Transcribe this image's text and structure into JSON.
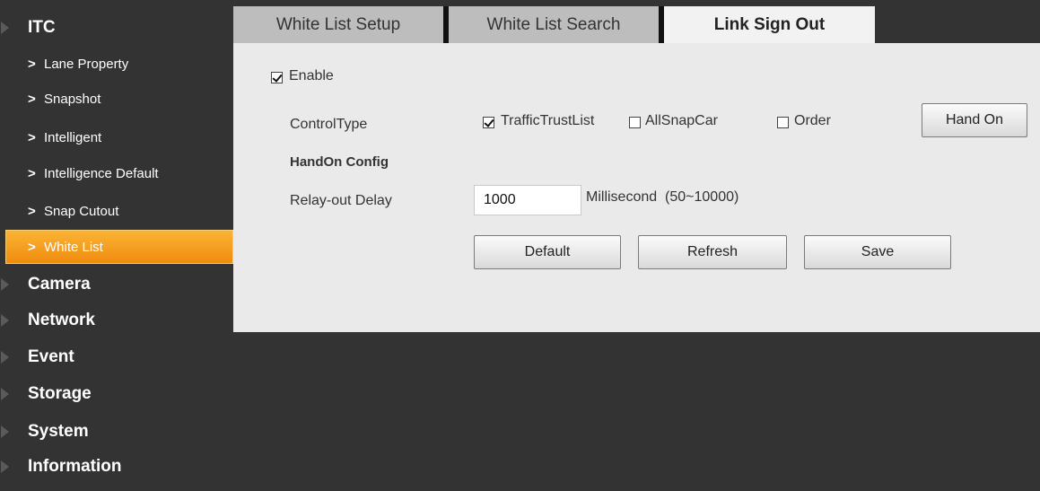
{
  "sidebar": {
    "itc": "ITC",
    "sub_items": [
      {
        "label": "Lane Property"
      },
      {
        "label": "Snapshot"
      },
      {
        "label": "Intelligent"
      },
      {
        "label": "Intelligence Default"
      },
      {
        "label": "Snap Cutout"
      },
      {
        "label": "White List"
      }
    ],
    "sections": [
      {
        "label": "Camera"
      },
      {
        "label": "Network"
      },
      {
        "label": "Event"
      },
      {
        "label": "Storage"
      },
      {
        "label": "System"
      },
      {
        "label": "Information"
      }
    ],
    "chevron": ">"
  },
  "tabs": [
    {
      "label": "White List Setup"
    },
    {
      "label": "White List Search"
    },
    {
      "label": "Link Sign Out"
    }
  ],
  "form": {
    "enable_label": "Enable",
    "enable_checked": true,
    "control_type_label": "ControlType",
    "control_options": [
      {
        "label": "TrafficTrustList",
        "checked": true
      },
      {
        "label": "AllSnapCar",
        "checked": false
      },
      {
        "label": "Order",
        "checked": false
      }
    ],
    "hand_on_button": "Hand On",
    "handon_config_title": "HandOn Config",
    "relay_delay_label": "Relay-out Delay",
    "relay_delay_value": "1000",
    "relay_delay_unit": "Millisecond",
    "relay_delay_range": "(50~10000)",
    "buttons": {
      "default": "Default",
      "refresh": "Refresh",
      "save": "Save"
    }
  },
  "colors": {
    "active_item": "#f6a21f",
    "background": "#333333",
    "panel": "#eaeaea"
  }
}
